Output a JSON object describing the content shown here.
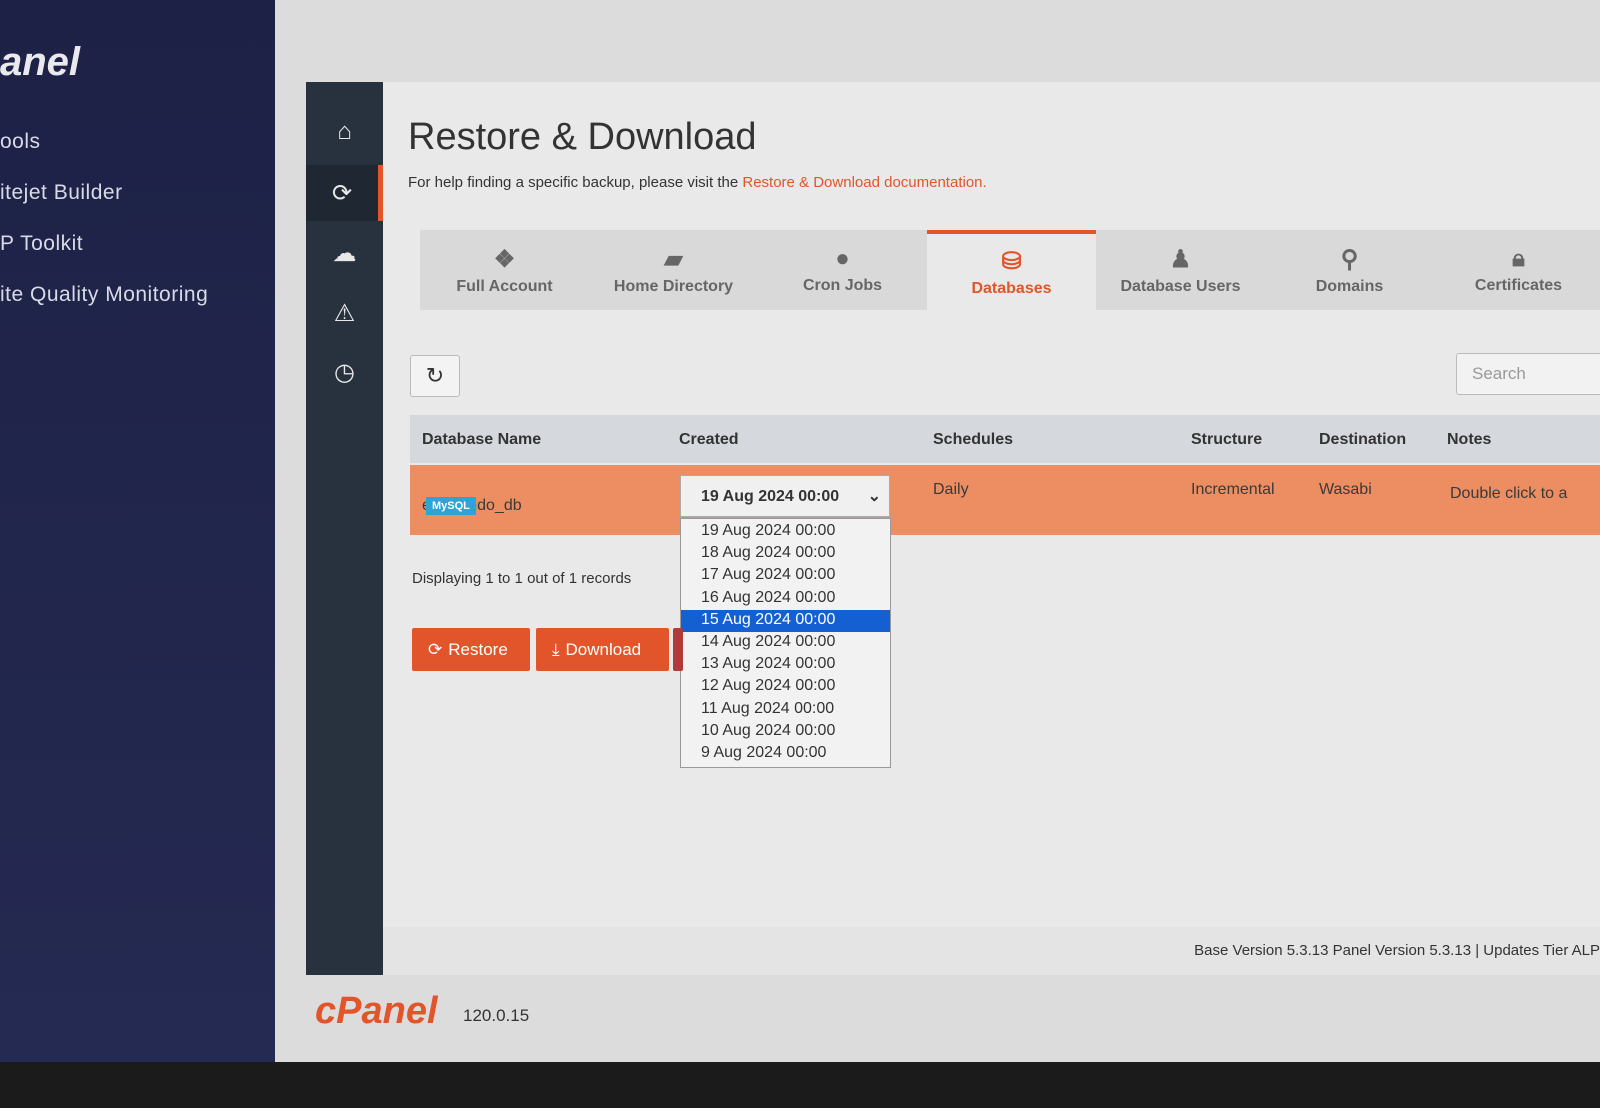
{
  "sidebar": {
    "logo": "anel",
    "items": [
      "ools",
      "itejet Builder",
      "P Toolkit",
      "ite Quality Monitoring"
    ]
  },
  "iconbar": [
    "home-icon",
    "restore-icon",
    "cloud-download-icon",
    "warning-icon",
    "clock-icon"
  ],
  "page": {
    "title": "Restore & Download",
    "help_prefix": "For help finding a specific backup, please visit the ",
    "help_link": "Restore & Download documentation."
  },
  "tabs": [
    {
      "label": "Full Account",
      "icon": "cubes-icon"
    },
    {
      "label": "Home Directory",
      "icon": "folder-icon"
    },
    {
      "label": "Cron Jobs",
      "icon": "user-clock-icon"
    },
    {
      "label": "Databases",
      "icon": "database-icon",
      "active": true
    },
    {
      "label": "Database Users",
      "icon": "user-tie-icon"
    },
    {
      "label": "Domains",
      "icon": "map-pin-icon"
    },
    {
      "label": "Certificates",
      "icon": "lock-icon"
    }
  ],
  "search": {
    "placeholder": "Search"
  },
  "table": {
    "headers": [
      "Database Name",
      "Created",
      "Schedules",
      "Structure",
      "Destination",
      "Notes"
    ],
    "row": {
      "name": "excelando_db",
      "badge": "MySQL",
      "created": "19 Aug 2024 00:00",
      "schedule": "Daily",
      "structure": "Incremental",
      "destination": "Wasabi",
      "notes": "Double click to a"
    }
  },
  "dropdown": {
    "options": [
      "19 Aug 2024 00:00",
      "18 Aug 2024 00:00",
      "17 Aug 2024 00:00",
      "16 Aug 2024 00:00",
      "15 Aug 2024 00:00",
      "14 Aug 2024 00:00",
      "13 Aug 2024 00:00",
      "12 Aug 2024 00:00",
      "11 Aug 2024 00:00",
      "10 Aug 2024 00:00",
      "9 Aug 2024 00:00"
    ],
    "highlighted": "15 Aug 2024 00:00"
  },
  "records": "Displaying 1 to 1 out of 1 records",
  "buttons": {
    "restore": "Restore",
    "download": "Download"
  },
  "footer": "Base Version 5.3.13 Panel Version 5.3.13 | Updates Tier ALP",
  "brand": {
    "logo": "cPanel",
    "version": "120.0.15"
  },
  "colors": {
    "accent": "#e2552b",
    "row": "#ec8d62",
    "highlight": "#1460d2",
    "badge": "#2fa4d4"
  }
}
